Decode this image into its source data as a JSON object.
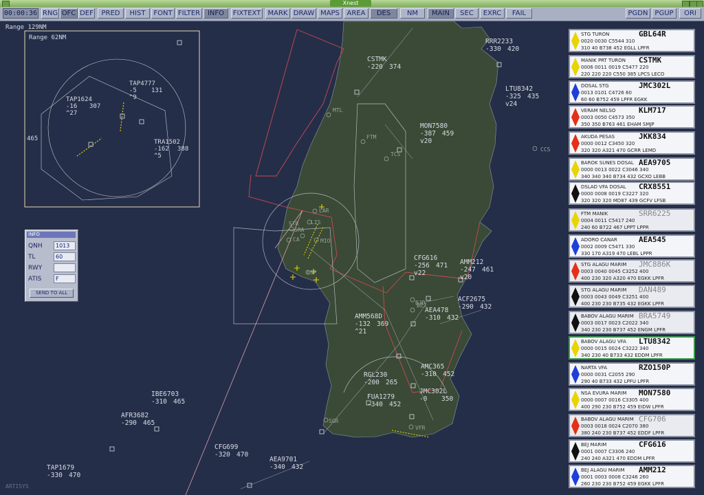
{
  "window": {
    "title": "Xnest"
  },
  "toolbar": {
    "clock": "00:00:36",
    "buttons": [
      "RNG",
      "OFC",
      "DEF",
      "PRED",
      "HIST",
      "FONT",
      "FILTER",
      "INFO",
      "FIXTEXT",
      "MARK",
      "DRAW",
      "MAPS",
      "AREA",
      "DES",
      "NM",
      "MAIN",
      "SEC",
      "EXRC",
      "FAIL",
      "PGDN",
      "PGUP",
      "ORI"
    ]
  },
  "radar": {
    "range_main": "Range 129NM",
    "range_inset": "Range 62NM",
    "watermark": "ARTISYS",
    "fixes": [
      "MTL",
      "FTM",
      "TCS",
      "CCS",
      "LAR",
      "STR",
      "LIS",
      "SRA",
      "CA",
      "MIO",
      "ESP",
      "BJD",
      "BEJ",
      "SGR",
      "VFR"
    ],
    "inset_tracks": [
      {
        "cs": "TAP1624",
        "alt": "-16",
        "spd": "307",
        "ext": "^27"
      },
      {
        "cs": "TAP4777",
        "alt": "-5",
        "spd": "131",
        "ext": "^9"
      },
      {
        "cs": "TRA1502",
        "alt": "-162",
        "spd": "388",
        "ext": "^5"
      }
    ],
    "inset_misc": "465",
    "tracks": [
      {
        "cs": "RRR2233",
        "alt": "-330",
        "spd": "420",
        "ext": ""
      },
      {
        "cs": "CSTMK",
        "alt": "-220",
        "spd": "374",
        "ext": ""
      },
      {
        "cs": "LTU8342",
        "alt": "-325",
        "spd": "435",
        "ext": "v24"
      },
      {
        "cs": "MON7580",
        "alt": "-387",
        "spd": "459",
        "ext": "v20"
      },
      {
        "cs": "CFG616",
        "alt": "-256",
        "spd": "471",
        "ext": "v22"
      },
      {
        "cs": "AMM212",
        "alt": "-247",
        "spd": "461",
        "ext": "v20"
      },
      {
        "cs": "ACF2675",
        "alt": "-290",
        "spd": "432",
        "ext": ""
      },
      {
        "cs": "AEA478",
        "alt": "-310",
        "spd": "432",
        "ext": ""
      },
      {
        "cs": "AMM568D",
        "alt": "-132",
        "spd": "369",
        "ext": "^21"
      },
      {
        "cs": "RGL230",
        "alt": "-200",
        "spd": "265",
        "ext": ""
      },
      {
        "cs": "AMC365",
        "alt": "-310",
        "spd": "452",
        "ext": ""
      },
      {
        "cs": "FUA1279",
        "alt": "-340",
        "spd": "452",
        "ext": ""
      },
      {
        "cs": "JMC302L",
        "alt": "-0",
        "spd": "350",
        "ext": ""
      },
      {
        "cs": "IBE6703",
        "alt": "-310",
        "spd": "465",
        "ext": ""
      },
      {
        "cs": "AFR3682",
        "alt": "-290",
        "spd": "465",
        "ext": ""
      },
      {
        "cs": "CFG699",
        "alt": "-320",
        "spd": "470",
        "ext": ""
      },
      {
        "cs": "AEA9701",
        "alt": "-340",
        "spd": "432",
        "ext": ""
      },
      {
        "cs": "TAP1679",
        "alt": "-330",
        "spd": "470",
        "ext": ""
      }
    ]
  },
  "info_panel": {
    "title": "INFO",
    "fields": [
      {
        "label": "QNH",
        "value": "1013"
      },
      {
        "label": "TL",
        "value": "60"
      },
      {
        "label": "RWY",
        "value": ""
      },
      {
        "label": "ATIS",
        "value": "F"
      }
    ],
    "send_button": "SEND TO ALL"
  },
  "strips": [
    {
      "callsign": "GBL64R",
      "color": "#e8d400",
      "dim": false,
      "sel": false,
      "l1": "STG           TURON",
      "l2": "0020          0030  C5544          310",
      "l3": "310          40  B738 452  EGLL  LPFR"
    },
    {
      "callsign": "CSTMK",
      "color": "#e8d400",
      "dim": false,
      "sel": false,
      "l1": "MANIK PRT  TURON",
      "l2": "0006  0011  0019  C5477          220",
      "l3": "220    220    220  C550 385  LPCS  LECO"
    },
    {
      "callsign": "JMC302L",
      "color": "#1f3fd8",
      "dim": false,
      "sel": false,
      "l1": "DOSAL         STG",
      "l2": "0013          0101  C4726            60",
      "l3": "60            60  B752 459  LPFR  EGKK"
    },
    {
      "callsign": "KLM717",
      "color": "#e43018",
      "dim": false,
      "sel": false,
      "l1": "VERAM       NELSO",
      "l2": "0003          0050  C4573          350",
      "l3": "350          350  B763 461  EHAM  SMJP"
    },
    {
      "callsign": "JKK834",
      "color": "#e43018",
      "dim": false,
      "sel": false,
      "l1": "AKUDA       PESAS",
      "l2": "0000          0012  C3450          320",
      "l3": "320          320  A321 470  GCRR  LEMD"
    },
    {
      "callsign": "AEA9705",
      "color": "#e8d400",
      "dim": false,
      "sel": false,
      "l1": "BAROK SUNES DOSAL",
      "l2": "0000  0013  0022  C3046          340",
      "l3": "340    340    340  B734 432  GCXO  LEBB"
    },
    {
      "callsign": "CRX8551",
      "color": "#111111",
      "dim": false,
      "sel": false,
      "l1": "DSLAD  VFA   DOSAL",
      "l2": "0000  0008  0019  C3227          320",
      "l3": "320    320    320  MD87 439  GCFV  LFSB"
    },
    {
      "callsign": "SRR6225",
      "color": "#e8d400",
      "dim": true,
      "sel": false,
      "l1": "FTM           MANIK",
      "l2": "0004          0011  C5417          240",
      "l3": "240            60  B722 467  LPPT  LPPR"
    },
    {
      "callsign": "AEA545",
      "color": "#1f3fd8",
      "dim": false,
      "sel": false,
      "l1": "ADORO       CANAR",
      "l2": "0002          0009  C5471          330",
      "l3": "330          170  A319 470  LEBL  LPPR"
    },
    {
      "callsign": "JMC886K",
      "color": "#e43018",
      "dim": true,
      "sel": false,
      "l1": "STG   ALAGU MARIM",
      "l2": "0003  0040  0045  C3252          400",
      "l3": "400    230    320  A320 470  EGKK  LPFR"
    },
    {
      "callsign": "DAN489",
      "color": "#111111",
      "dim": true,
      "sel": false,
      "l1": "STG   ALAGU MARIM",
      "l2": "0003  0043  0049  C3251          400",
      "l3": "400    230    230  B735 432  EGKK  LPFR"
    },
    {
      "callsign": "BRA5749",
      "color": "#111111",
      "dim": true,
      "sel": false,
      "l1": "BABOV ALAGU MARIM",
      "l2": "0003  0017  0023  C2022          340",
      "l3": "340    230    230  B737 452  ENGM  LPFR"
    },
    {
      "callsign": "LTU8342",
      "color": "#e8d400",
      "dim": false,
      "sel": true,
      "l1": "BABOV ALAGU VFA",
      "l2": "0000  0015  0024  C3222          340",
      "l3": "340    230      40  B733 432  EDDM  LPFR"
    },
    {
      "callsign": "RZO150P",
      "color": "#1f3fd8",
      "dim": false,
      "sel": false,
      "l1": "NARTA         VFA",
      "l2": "0000          0031  C2055          290",
      "l3": "290            40  B733 432  LPFU  LPFR"
    },
    {
      "callsign": "MON7580",
      "color": "#e8d400",
      "dim": false,
      "sel": false,
      "l1": "NSA   EVURA MARIM",
      "l2": "0000  0007  0016  C3305          400",
      "l3": "400    290    230  B752 459  EIDW  LPFR"
    },
    {
      "callsign": "CFG706",
      "color": "#e43018",
      "dim": true,
      "sel": false,
      "l1": "BABOV ALAGU MARIM",
      "l2": "0003  0018  0024  C2070          380",
      "l3": "380    240    230  B737 452  EDDF  LPFR"
    },
    {
      "callsign": "CFG616",
      "color": "#111111",
      "dim": false,
      "sel": false,
      "l1": "BEJ           MARIM",
      "l2": "0001          0007  C3306          240",
      "l3": "240          240  A321 470  EDDM  LPFR"
    },
    {
      "callsign": "AMM212",
      "color": "#1f3fd8",
      "dim": false,
      "sel": false,
      "l1": "BEJ   ALAGU MARIM",
      "l2": "0001  0003  0008  C3246          260",
      "l3": "260    230    230  B752 459  EGKK  LPFR"
    }
  ]
}
